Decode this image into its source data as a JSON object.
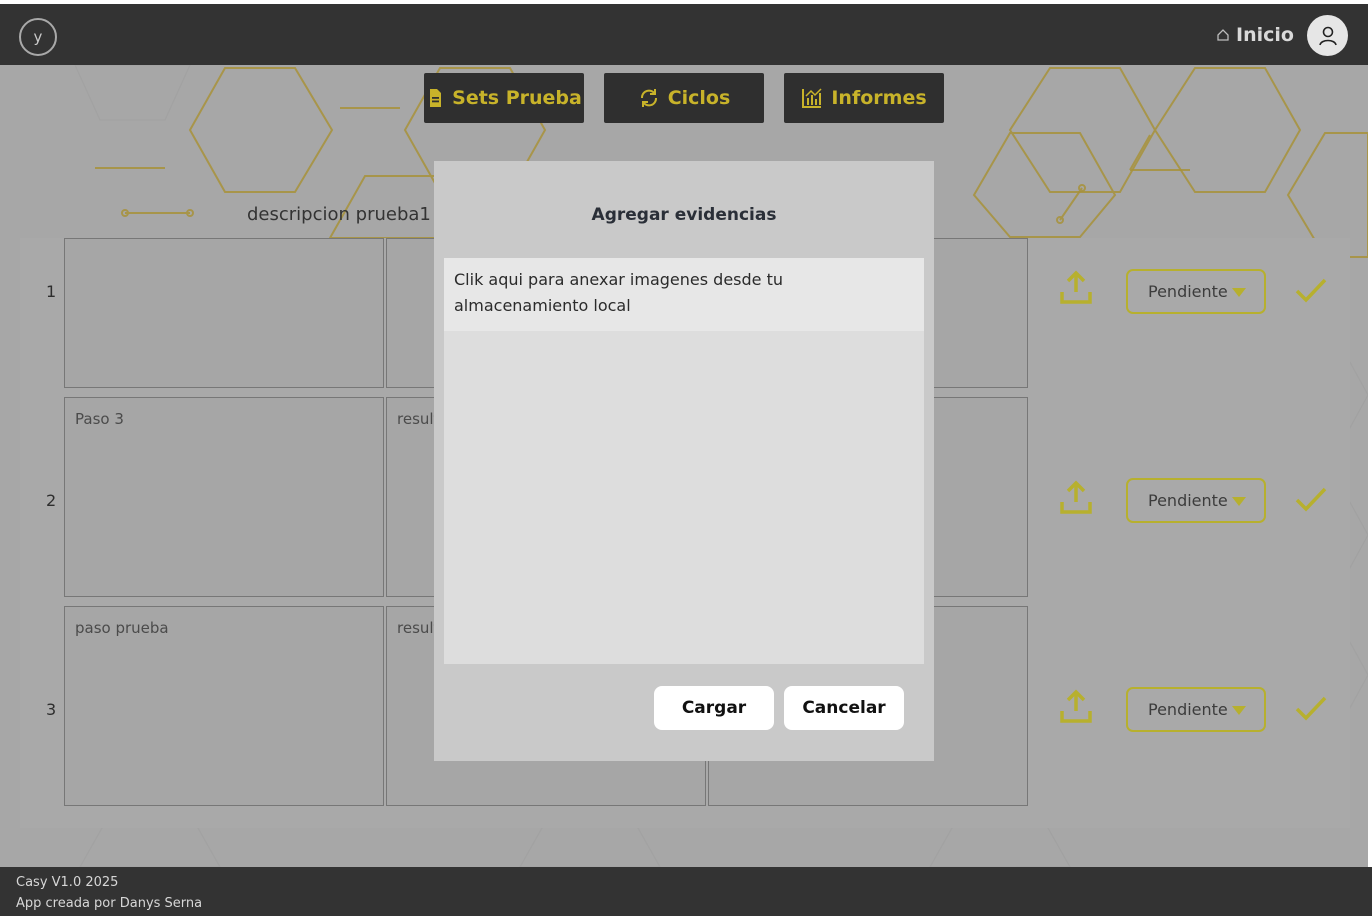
{
  "header": {
    "logo_text": "y",
    "home_label": "Inicio"
  },
  "nav": {
    "sets_label": "Sets Prueba",
    "ciclos_label": "Ciclos",
    "informes_label": "Informes"
  },
  "test": {
    "description": "descripcion prueba1"
  },
  "steps": [
    {
      "number": "1",
      "paso": "",
      "resultado": "",
      "status": "Pendiente"
    },
    {
      "number": "2",
      "paso": "Paso 3",
      "resultado": "result",
      "status": "Pendiente"
    },
    {
      "number": "3",
      "paso": "paso prueba",
      "resultado": "result",
      "status": "Pendiente"
    }
  ],
  "modal": {
    "title": "Agregar evidencias",
    "dropzone_text": "Clik aqui para anexar imagenes desde tu almacenamiento local",
    "cargar_label": "Cargar",
    "cancelar_label": "Cancelar"
  },
  "footer": {
    "version": "Casy V1.0 2025",
    "credits": "App creada por Danys Serna"
  },
  "colors": {
    "accent": "#c8b32a",
    "header_bg": "#333333",
    "overlay_bg": "#a7a7a7",
    "modal_bg": "#c9c9c9"
  }
}
